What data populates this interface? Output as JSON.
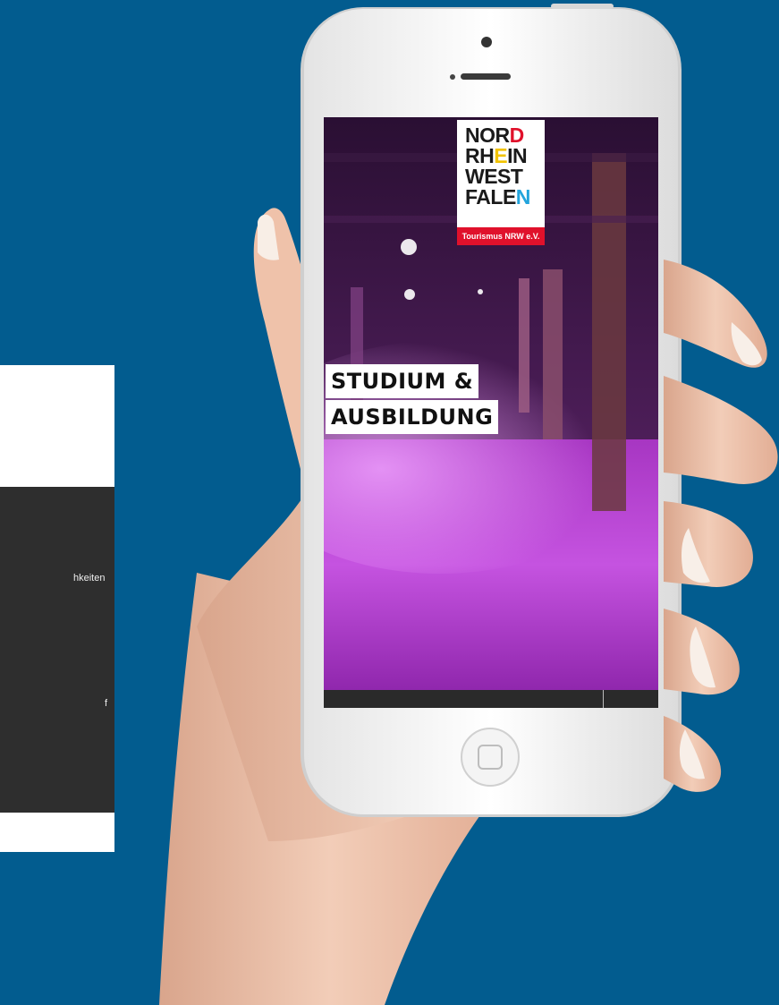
{
  "background_card": {
    "text_line_1": "hkeiten",
    "text_line_2": "f"
  },
  "phone_screen": {
    "logo": {
      "lines": [
        {
          "parts": [
            "NOR",
            "D"
          ],
          "accent": "#e0112b"
        },
        {
          "parts": [
            "RH",
            "E",
            "IN"
          ],
          "accent": "#f2c300"
        },
        {
          "parts": [
            "WEST"
          ]
        },
        {
          "parts": [
            "FALE",
            "N"
          ],
          "accent": "#22a4dc"
        }
      ],
      "tagline": "Tourismus NRW e.V."
    },
    "headline_line_1": "STUDIUM &",
    "headline_line_2": "AUSBILDUNG"
  },
  "colors": {
    "background": "#025c8f",
    "screen_tint": "#b53ad1",
    "logo_red": "#e0112b"
  }
}
